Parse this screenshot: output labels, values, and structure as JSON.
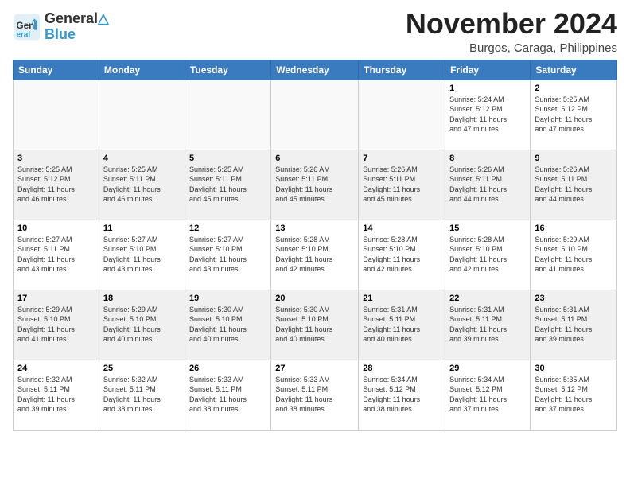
{
  "header": {
    "logo_line1": "General",
    "logo_line2": "Blue",
    "month": "November 2024",
    "location": "Burgos, Caraga, Philippines"
  },
  "days_of_week": [
    "Sunday",
    "Monday",
    "Tuesday",
    "Wednesday",
    "Thursday",
    "Friday",
    "Saturday"
  ],
  "weeks": [
    [
      {
        "day": "",
        "info": ""
      },
      {
        "day": "",
        "info": ""
      },
      {
        "day": "",
        "info": ""
      },
      {
        "day": "",
        "info": ""
      },
      {
        "day": "",
        "info": ""
      },
      {
        "day": "1",
        "info": "Sunrise: 5:24 AM\nSunset: 5:12 PM\nDaylight: 11 hours\nand 47 minutes."
      },
      {
        "day": "2",
        "info": "Sunrise: 5:25 AM\nSunset: 5:12 PM\nDaylight: 11 hours\nand 47 minutes."
      }
    ],
    [
      {
        "day": "3",
        "info": "Sunrise: 5:25 AM\nSunset: 5:12 PM\nDaylight: 11 hours\nand 46 minutes."
      },
      {
        "day": "4",
        "info": "Sunrise: 5:25 AM\nSunset: 5:11 PM\nDaylight: 11 hours\nand 46 minutes."
      },
      {
        "day": "5",
        "info": "Sunrise: 5:25 AM\nSunset: 5:11 PM\nDaylight: 11 hours\nand 45 minutes."
      },
      {
        "day": "6",
        "info": "Sunrise: 5:26 AM\nSunset: 5:11 PM\nDaylight: 11 hours\nand 45 minutes."
      },
      {
        "day": "7",
        "info": "Sunrise: 5:26 AM\nSunset: 5:11 PM\nDaylight: 11 hours\nand 45 minutes."
      },
      {
        "day": "8",
        "info": "Sunrise: 5:26 AM\nSunset: 5:11 PM\nDaylight: 11 hours\nand 44 minutes."
      },
      {
        "day": "9",
        "info": "Sunrise: 5:26 AM\nSunset: 5:11 PM\nDaylight: 11 hours\nand 44 minutes."
      }
    ],
    [
      {
        "day": "10",
        "info": "Sunrise: 5:27 AM\nSunset: 5:11 PM\nDaylight: 11 hours\nand 43 minutes."
      },
      {
        "day": "11",
        "info": "Sunrise: 5:27 AM\nSunset: 5:10 PM\nDaylight: 11 hours\nand 43 minutes."
      },
      {
        "day": "12",
        "info": "Sunrise: 5:27 AM\nSunset: 5:10 PM\nDaylight: 11 hours\nand 43 minutes."
      },
      {
        "day": "13",
        "info": "Sunrise: 5:28 AM\nSunset: 5:10 PM\nDaylight: 11 hours\nand 42 minutes."
      },
      {
        "day": "14",
        "info": "Sunrise: 5:28 AM\nSunset: 5:10 PM\nDaylight: 11 hours\nand 42 minutes."
      },
      {
        "day": "15",
        "info": "Sunrise: 5:28 AM\nSunset: 5:10 PM\nDaylight: 11 hours\nand 42 minutes."
      },
      {
        "day": "16",
        "info": "Sunrise: 5:29 AM\nSunset: 5:10 PM\nDaylight: 11 hours\nand 41 minutes."
      }
    ],
    [
      {
        "day": "17",
        "info": "Sunrise: 5:29 AM\nSunset: 5:10 PM\nDaylight: 11 hours\nand 41 minutes."
      },
      {
        "day": "18",
        "info": "Sunrise: 5:29 AM\nSunset: 5:10 PM\nDaylight: 11 hours\nand 40 minutes."
      },
      {
        "day": "19",
        "info": "Sunrise: 5:30 AM\nSunset: 5:10 PM\nDaylight: 11 hours\nand 40 minutes."
      },
      {
        "day": "20",
        "info": "Sunrise: 5:30 AM\nSunset: 5:10 PM\nDaylight: 11 hours\nand 40 minutes."
      },
      {
        "day": "21",
        "info": "Sunrise: 5:31 AM\nSunset: 5:11 PM\nDaylight: 11 hours\nand 40 minutes."
      },
      {
        "day": "22",
        "info": "Sunrise: 5:31 AM\nSunset: 5:11 PM\nDaylight: 11 hours\nand 39 minutes."
      },
      {
        "day": "23",
        "info": "Sunrise: 5:31 AM\nSunset: 5:11 PM\nDaylight: 11 hours\nand 39 minutes."
      }
    ],
    [
      {
        "day": "24",
        "info": "Sunrise: 5:32 AM\nSunset: 5:11 PM\nDaylight: 11 hours\nand 39 minutes."
      },
      {
        "day": "25",
        "info": "Sunrise: 5:32 AM\nSunset: 5:11 PM\nDaylight: 11 hours\nand 38 minutes."
      },
      {
        "day": "26",
        "info": "Sunrise: 5:33 AM\nSunset: 5:11 PM\nDaylight: 11 hours\nand 38 minutes."
      },
      {
        "day": "27",
        "info": "Sunrise: 5:33 AM\nSunset: 5:11 PM\nDaylight: 11 hours\nand 38 minutes."
      },
      {
        "day": "28",
        "info": "Sunrise: 5:34 AM\nSunset: 5:12 PM\nDaylight: 11 hours\nand 38 minutes."
      },
      {
        "day": "29",
        "info": "Sunrise: 5:34 AM\nSunset: 5:12 PM\nDaylight: 11 hours\nand 37 minutes."
      },
      {
        "day": "30",
        "info": "Sunrise: 5:35 AM\nSunset: 5:12 PM\nDaylight: 11 hours\nand 37 minutes."
      }
    ]
  ]
}
